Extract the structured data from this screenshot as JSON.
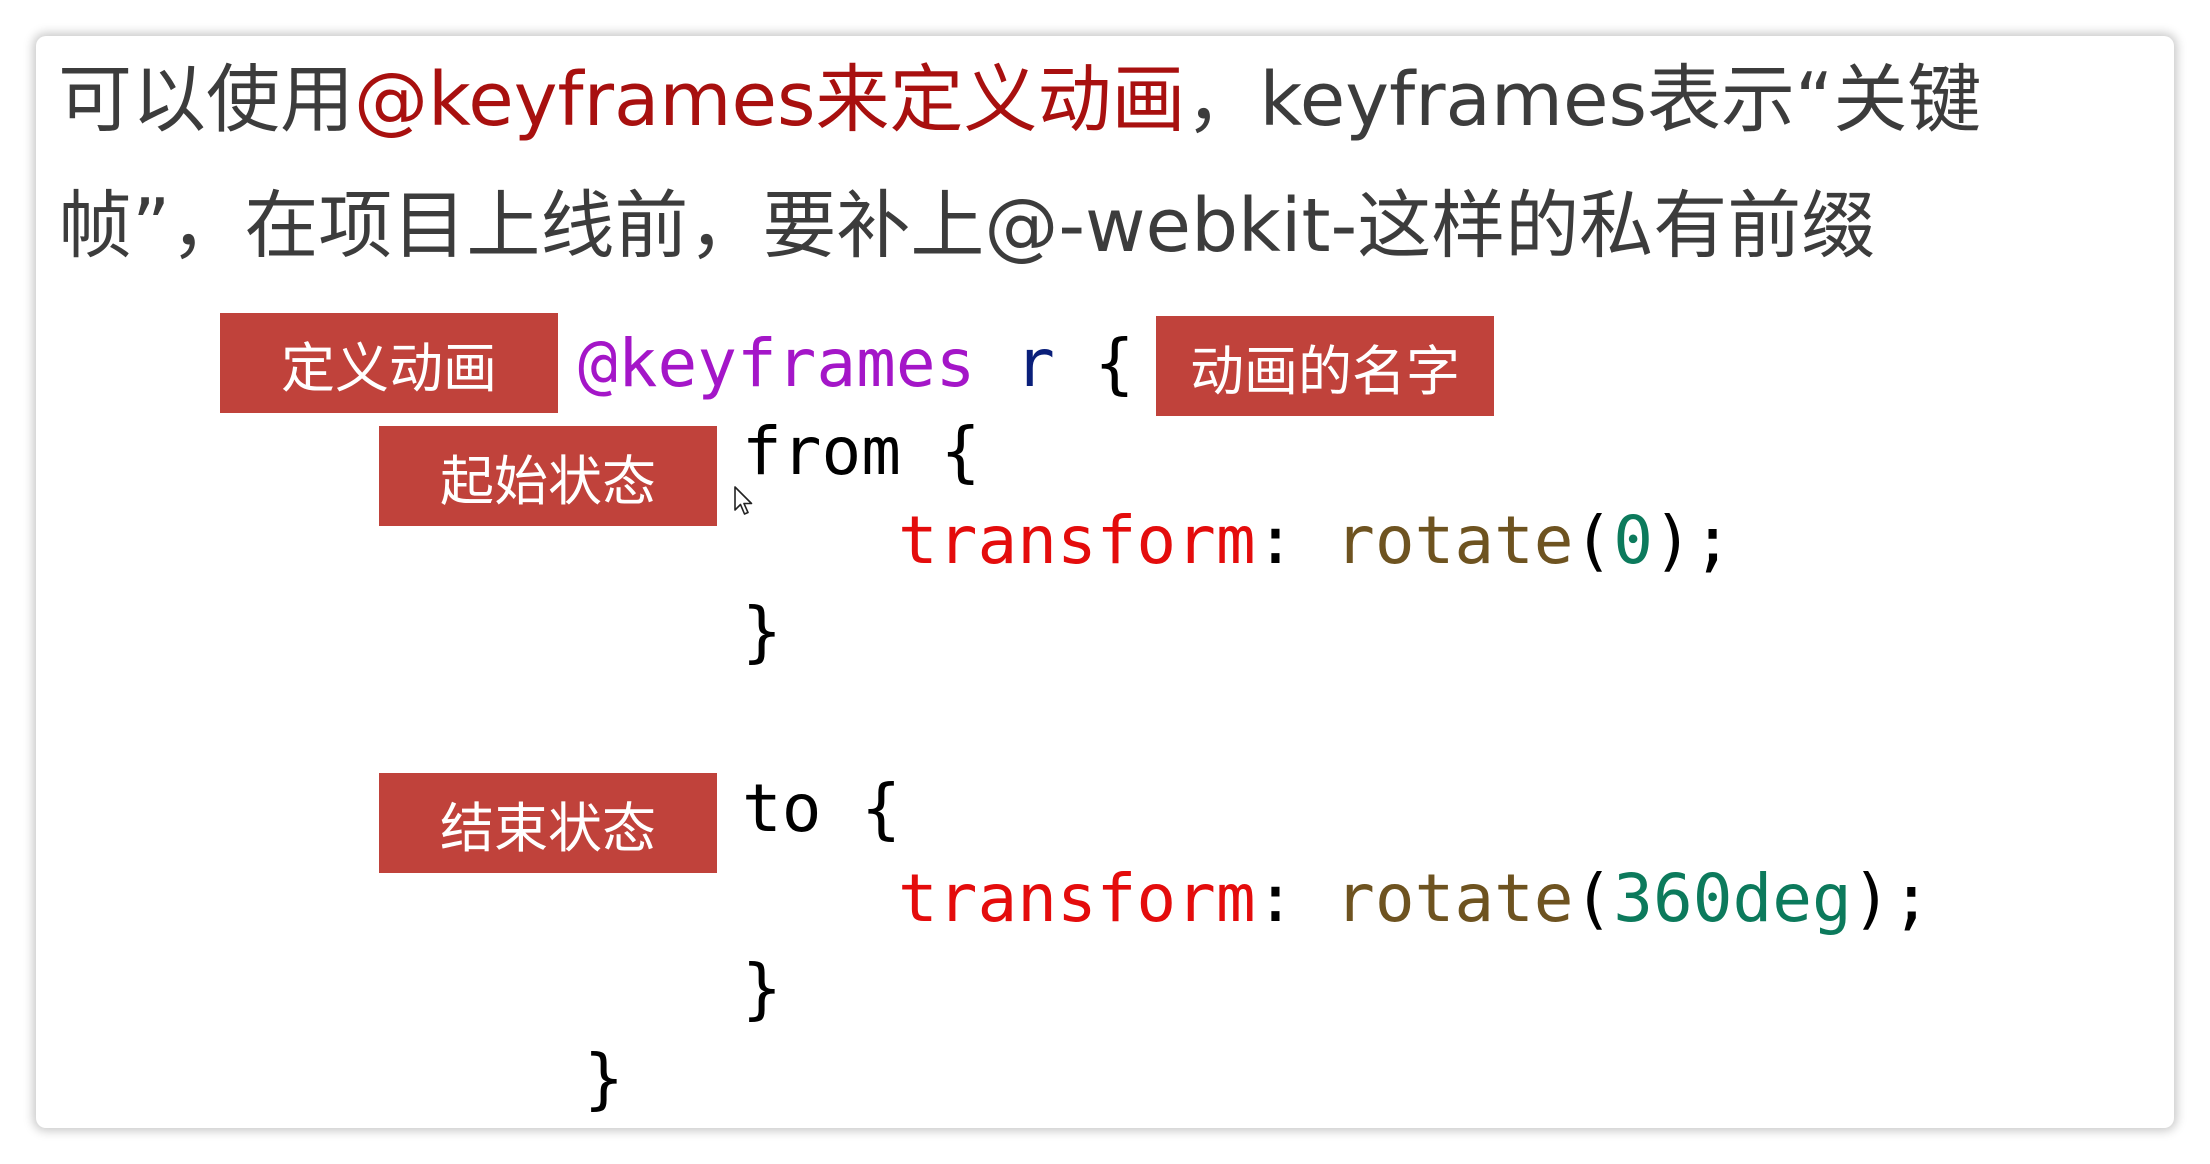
{
  "intro": {
    "line1_prefix": "可以使用",
    "line1_highlight": "@keyframes来定义动画",
    "line1_suffix": "，keyframes表示“关键",
    "line2": "帧”，在项目上线前，要补上@-webkit-这样的私有前缀"
  },
  "tags": {
    "define": "定义动画",
    "name": "动画的名字",
    "start": "起始状态",
    "end": "结束状态"
  },
  "code": {
    "at_rule": "@keyframes",
    "anim_name": "r",
    "open_brace": "{",
    "close_brace": "}",
    "from": "from",
    "to": "to",
    "property": "transform",
    "colon": ":",
    "func": "rotate",
    "paren_open": "(",
    "paren_close": ")",
    "semicolon": ";",
    "from_value": "0",
    "to_value": "360deg"
  },
  "icons": {
    "cursor": "mouse-pointer-icon"
  },
  "colors": {
    "highlight": "#a8100f",
    "tag_bg": "#c0423b",
    "keyword": "#a416c8",
    "identifier": "#0a1f7a",
    "property": "#e40c0c",
    "function": "#6e5320",
    "number": "#0c7a5c"
  }
}
